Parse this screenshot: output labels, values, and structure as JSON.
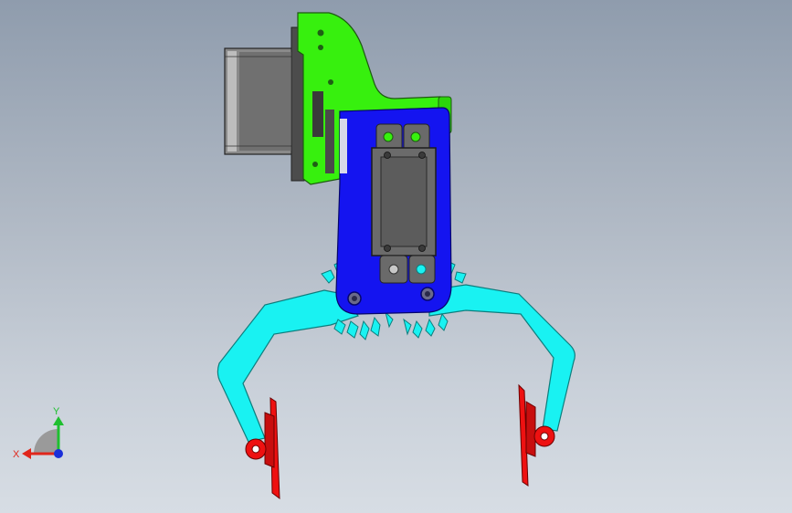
{
  "triad": {
    "x_label": "X",
    "y_label": "Y",
    "x_color": "#e0261b",
    "y_color": "#1fbf2f",
    "z_color": "#1a2fd9"
  },
  "model": {
    "motor_color": "#707070",
    "bracket_color": "#37f00e",
    "plate_color": "#1414f0",
    "arm_color": "#19f2f2",
    "finger_color": "#ee1111",
    "servo_color": "#5c5c5c"
  }
}
